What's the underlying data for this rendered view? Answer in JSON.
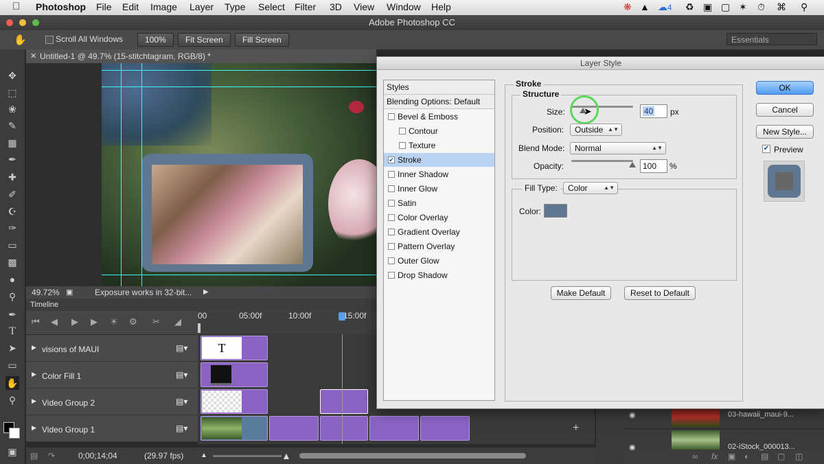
{
  "menubar": {
    "apple_icon": "apple-icon",
    "app": "Photoshop",
    "items": [
      "File",
      "Edit",
      "Image",
      "Layer",
      "Type",
      "Select",
      "Filter",
      "3D",
      "View",
      "Window",
      "Help"
    ],
    "cc_count": "4"
  },
  "window_title": "Adobe Photoshop CC",
  "options": {
    "scroll_all": "Scroll All Windows",
    "zoom_pct": "100%",
    "fit_screen": "Fit Screen",
    "fill_screen": "Fill Screen",
    "workspace": "Essentials"
  },
  "document": {
    "tab": "Untitled-1 @ 49.7% (15-stitchtagram, RGB/8) *",
    "zoom": "49.72%",
    "status": "Exposure works in 32-bit..."
  },
  "timeline": {
    "title": "Timeline",
    "ruler": [
      "00",
      "05:00f",
      "10:00f",
      "15:00f"
    ],
    "tracks": [
      "visions of MAUI",
      "Color Fill 1",
      "Video Group 2",
      "Video Group 1"
    ],
    "timecode": "0;00;14;04",
    "fps": "(29.97 fps)",
    "text_clip": "T"
  },
  "layers": {
    "items": [
      "03-hawaii_maui-9...",
      "02-iStock_000013..."
    ]
  },
  "dialog": {
    "title": "Layer Style",
    "styles_header": "Styles",
    "blending": "Blending Options: Default",
    "styles": [
      {
        "label": "Bevel & Emboss",
        "checked": false
      },
      {
        "label": "Contour",
        "checked": false,
        "indent": true
      },
      {
        "label": "Texture",
        "checked": false,
        "indent": true
      },
      {
        "label": "Stroke",
        "checked": true,
        "selected": true
      },
      {
        "label": "Inner Shadow",
        "checked": false
      },
      {
        "label": "Inner Glow",
        "checked": false
      },
      {
        "label": "Satin",
        "checked": false
      },
      {
        "label": "Color Overlay",
        "checked": false
      },
      {
        "label": "Gradient Overlay",
        "checked": false
      },
      {
        "label": "Pattern Overlay",
        "checked": false
      },
      {
        "label": "Outer Glow",
        "checked": false
      },
      {
        "label": "Drop Shadow",
        "checked": false
      }
    ],
    "stroke": {
      "section": "Stroke",
      "structure": "Structure",
      "size_label": "Size:",
      "size_value": "40",
      "size_unit": "px",
      "position_label": "Position:",
      "position_value": "Outside",
      "blend_label": "Blend Mode:",
      "blend_value": "Normal",
      "opacity_label": "Opacity:",
      "opacity_value": "100",
      "opacity_unit": "%",
      "fill_label": "Fill Type:",
      "fill_value": "Color",
      "color_label": "Color:",
      "color_swatch": "#5e7690"
    },
    "buttons": {
      "ok": "OK",
      "cancel": "Cancel",
      "new_style": "New Style...",
      "preview": "Preview",
      "make_default": "Make Default",
      "reset_default": "Reset to Default"
    }
  }
}
